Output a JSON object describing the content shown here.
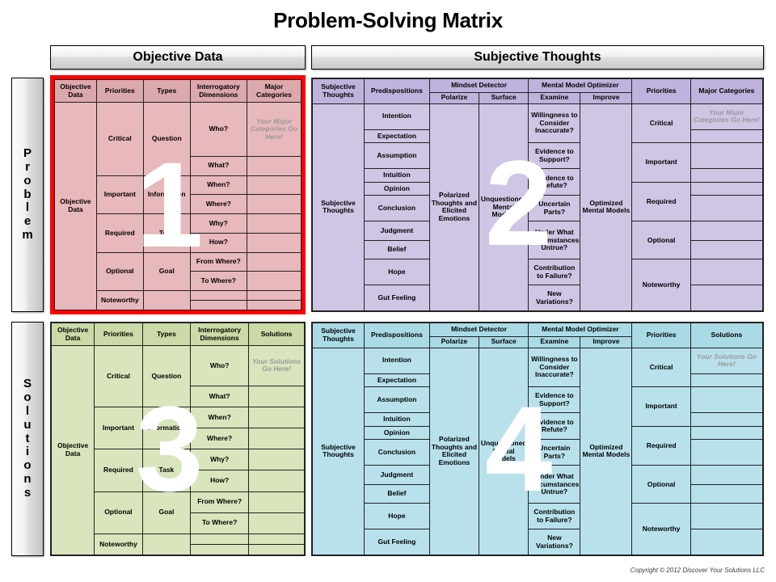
{
  "title": "Problem-Solving Matrix",
  "column_headers": {
    "objective": "Objective Data",
    "subjective": "Subjective Thoughts"
  },
  "row_headers": {
    "problem": "Problem",
    "solutions": "Solutions"
  },
  "copyright": "Copyright © 2012 Discover Your Solutions LLC",
  "watermarks": {
    "q1": "1",
    "q2": "2",
    "q3": "3",
    "q4": "4"
  },
  "colors": {
    "quadrant1_header": "#dba8ad",
    "quadrant1_body": "#e7b8bc",
    "quadrant1_border": "#ff0000",
    "quadrant2_header": "#bfb2dc",
    "quadrant2_body": "#cfc5e4",
    "quadrant3_header": "#cbdaa6",
    "quadrant3_body": "#d9e5bd",
    "quadrant4_header": "#a9dae6",
    "quadrant4_body": "#b8e1ec",
    "grid_line": "#222222",
    "watermark": "#ffffff"
  },
  "objective_side": {
    "headers": {
      "objective_data": "Objective Data",
      "priorities": "Priorities",
      "types": "Types",
      "interrogatory_dimensions": "Interrogatory Dimensions",
      "major_categories": "Major Categories",
      "solutions": "Solutions"
    },
    "objective_data_label": "Objective Data",
    "priorities": [
      "Critical",
      "Important",
      "Required",
      "Optional",
      "Noteworthy"
    ],
    "types": [
      "Question",
      "Information",
      "Task",
      "Goal"
    ],
    "interrogatory_dimensions": [
      "Who?",
      "What?",
      "When?",
      "Where?",
      "Why?",
      "How?",
      "From Where?",
      "To Where?"
    ],
    "major_categories_placeholder": "Your Major Categories Go Here!",
    "solutions_placeholder": "Your Solutions Go Here!"
  },
  "subjective_side": {
    "headers": {
      "subjective_thoughts": "Subjective Thoughts",
      "predispositions": "Predispositions",
      "mindset_detector": "Mindset Detector",
      "mental_model_optimizer": "Mental Model Optimizer",
      "polarize": "Polarize",
      "surface": "Surface",
      "examine": "Examine",
      "improve": "Improve",
      "priorities": "Priorities",
      "major_categories": "Major Categories",
      "solutions": "Solutions"
    },
    "subjective_thoughts_label": "Subjective Thoughts",
    "predispositions": [
      "Intention",
      "Expectation",
      "Assumption",
      "Intuition",
      "Opinion",
      "Conclusion",
      "Judgment",
      "Belief",
      "Hope",
      "Gut Feeling"
    ],
    "polarize_value": "Polarized Thoughts and Elicited Emotions",
    "surface_value": "Unquestioned Mental Models",
    "examine": [
      "Willingness to Consider Inaccurate?",
      "Evidence to Support?",
      "Evidence to Refute?",
      "Uncertain Parts?",
      "Under What Circumstances Untrue?",
      "Contribution to Failure?",
      "New Variations?"
    ],
    "improve_value": "Optimized Mental Models",
    "priorities": [
      "Critical",
      "Important",
      "Required",
      "Optional",
      "Noteworthy"
    ],
    "major_categories_placeholder": "Your Major Categories Go Here!",
    "solutions_placeholder": "Your Solutions Go Here!"
  }
}
